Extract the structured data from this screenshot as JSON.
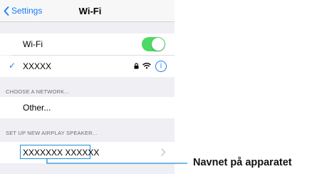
{
  "nav": {
    "back_label": "Settings",
    "title": "Wi-Fi"
  },
  "wifi_row": {
    "label": "Wi-Fi",
    "toggle_on": true,
    "toggle_color": "#4cd964"
  },
  "connected_network": {
    "name": "XXXXX",
    "icons": [
      "checkmark-icon",
      "lock-icon",
      "wifi-signal-icon",
      "info-icon"
    ],
    "info_glyph": "i"
  },
  "choose_network": {
    "header": "CHOOSE A NETWORK...",
    "other_label": "Other..."
  },
  "airplay": {
    "header": "SET UP NEW AIRPLAY SPEAKER...",
    "device_name": "XXXXXXX  XXXXXX"
  },
  "annotation": {
    "label": "Navnet på apparatet"
  },
  "colors": {
    "accent": "#1a7cf5",
    "highlight": "#1e90d6"
  }
}
